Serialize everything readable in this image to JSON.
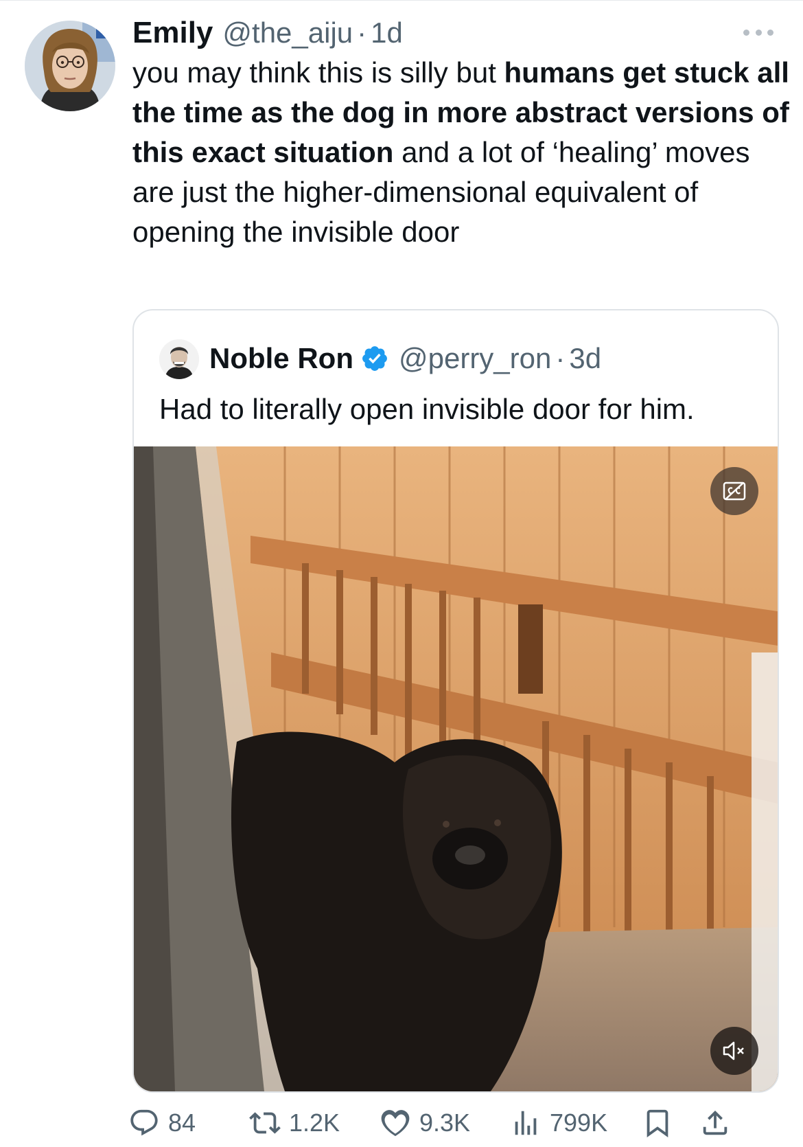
{
  "tweet": {
    "author_name": "Emily",
    "author_handle": "@the_aiju",
    "separator": "·",
    "timestamp": "1d",
    "text_plain_1": "you may think this is silly but ",
    "text_bold": "humans get stuck all the time as the dog in more abstract versions of this exact situation",
    "text_plain_2": " and a lot of ‘healing’ moves are just the higher-dimensional equivalent of opening the invisible door"
  },
  "quoted": {
    "author_name": "Noble Ron",
    "verified": true,
    "author_handle": "@perry_ron",
    "separator": "·",
    "timestamp": "3d",
    "text": "Had to literally open invisible door for him."
  },
  "media": {
    "type": "video",
    "captions_icon": "closed-captions-icon",
    "mute_icon": "muted-speaker-icon"
  },
  "actions": {
    "replies": "84",
    "reposts": "1.2K",
    "likes": "9.3K",
    "views": "799K"
  },
  "colors": {
    "text_primary": "#0f1419",
    "text_secondary": "#536471",
    "verified_blue": "#1d9bf0",
    "border": "#dfe3e7"
  }
}
